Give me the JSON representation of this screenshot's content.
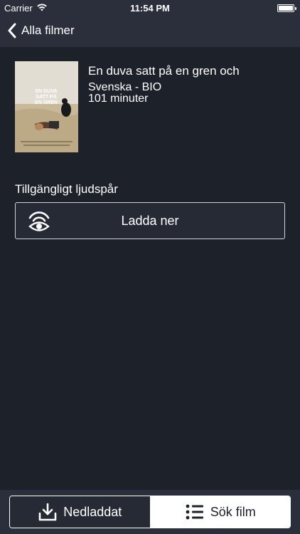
{
  "status": {
    "carrier": "Carrier",
    "time": "11:54 PM",
    "battery_level": 1.0
  },
  "nav": {
    "back_label": "Alla filmer",
    "back_icon": "chevron-left-icon"
  },
  "movie": {
    "title": "En duva satt på en gren och",
    "language_line": "Svenska - BIO",
    "duration": "101 minuter",
    "poster_text": [
      "EN DUVA",
      "SATT PÅ",
      "EN GREN"
    ]
  },
  "audio": {
    "section_label": "Tillgängligt ljudspår",
    "download_label": "Ladda ner",
    "download_icon": "wifi-ear-icon"
  },
  "tabbar": {
    "tabs": [
      {
        "label": "Nedladdat",
        "icon": "download-tray-icon",
        "selected": false
      },
      {
        "label": "Sök film",
        "icon": "list-icon",
        "selected": true
      }
    ]
  },
  "colors": {
    "background": "#1d212a",
    "bar": "#2b2f3b",
    "text": "#ffffff"
  }
}
